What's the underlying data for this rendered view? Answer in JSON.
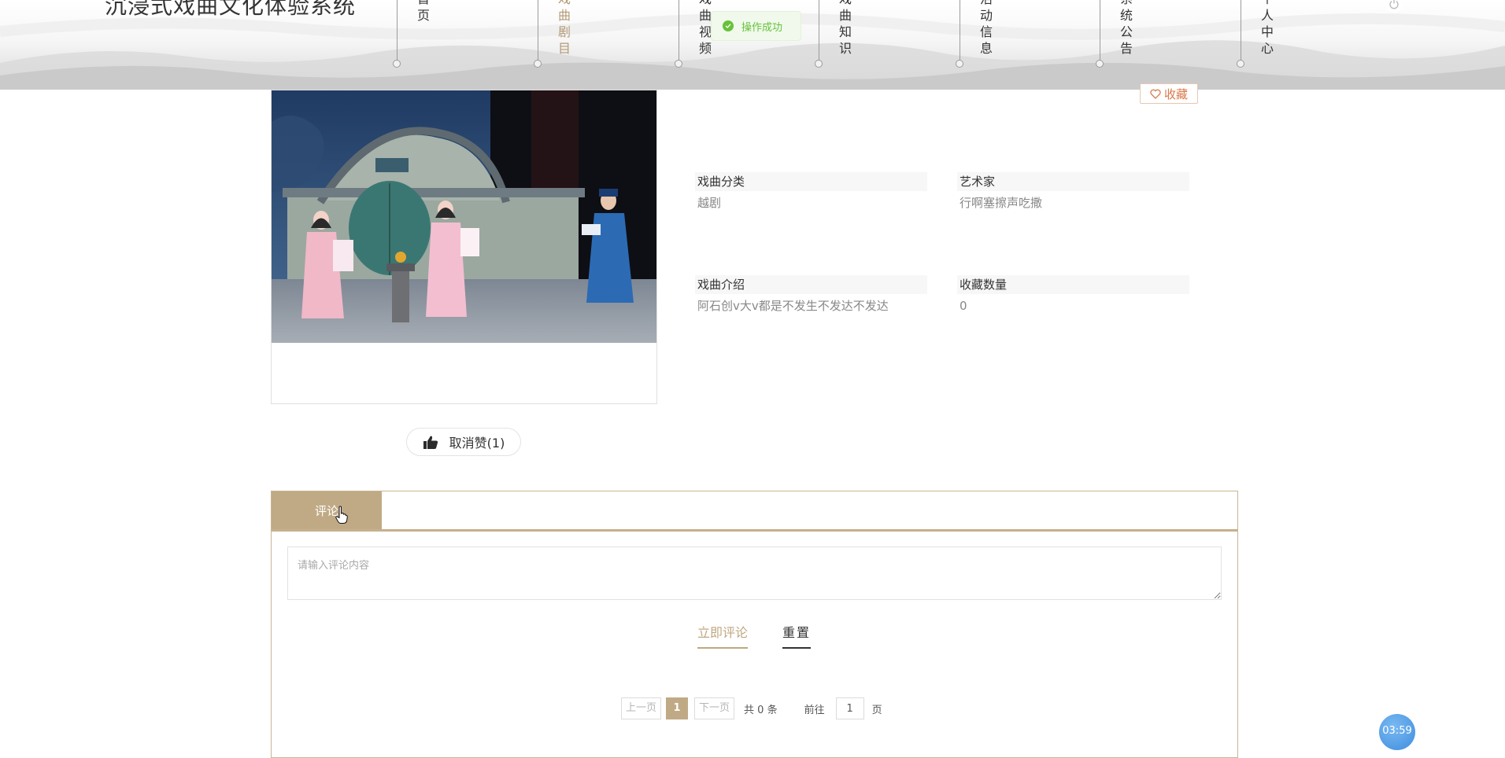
{
  "header": {
    "site_title": "沉浸式戏曲文化体验系统",
    "nav": [
      {
        "label": "首页"
      },
      {
        "label": "戏曲剧目",
        "active": true
      },
      {
        "label": "戏曲视频"
      },
      {
        "label": "戏曲知识"
      },
      {
        "label": "活动信息"
      },
      {
        "label": "系统公告"
      },
      {
        "label": "个人中心"
      }
    ]
  },
  "toast": {
    "message": "操作成功"
  },
  "detail": {
    "favorite_label": "收藏",
    "fields": [
      {
        "label": "戏曲分类",
        "value": "越剧"
      },
      {
        "label": "艺术家",
        "value": "行啊塞擦声吃撒"
      },
      {
        "label": "戏曲介绍",
        "value": "阿石创v大v都是不发生不发达不发达"
      },
      {
        "label": "收藏数量",
        "value": "0"
      }
    ],
    "like_button": "取消赞(1)"
  },
  "comments": {
    "tab_label": "评论",
    "placeholder": "请输入评论内容",
    "submit_label": "立即评论",
    "reset_label": "重置",
    "pagination": {
      "prev": "上一页",
      "next": "下一页",
      "current_page": "1",
      "total": "共 0 条",
      "goto": "前往",
      "goto_value": "1",
      "page_suffix": "页"
    }
  },
  "timer": "03:59",
  "colors": {
    "accent": "#c0aa86",
    "success": "#67c23a",
    "favorite": "#d9784a"
  }
}
